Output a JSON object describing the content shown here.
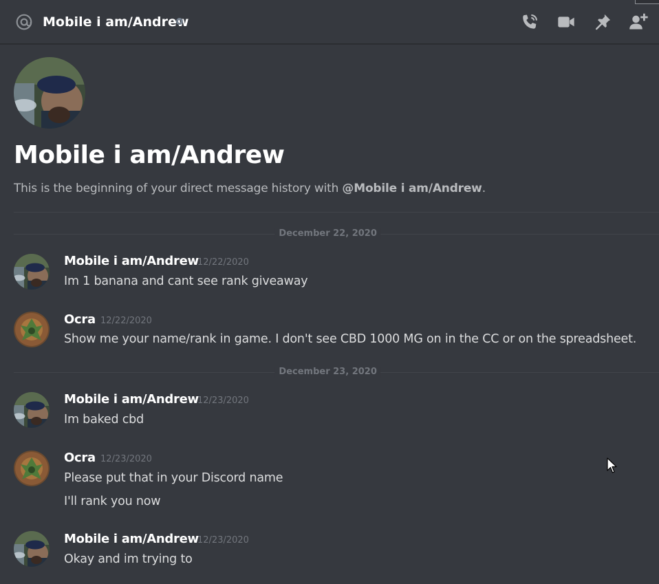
{
  "header": {
    "title": "Mobile i am/Andrew",
    "icons": [
      "at-icon",
      "status-offline-dot",
      "call-icon",
      "video-icon",
      "pin-icon",
      "add-friend-icon"
    ]
  },
  "intro": {
    "title": "Mobile i am/Andrew",
    "subtitle_prefix": "This is the beginning of your direct message history with ",
    "subtitle_mention": "@Mobile i am/Andrew",
    "subtitle_suffix": "."
  },
  "dividers": [
    {
      "date": "December 22, 2020"
    },
    {
      "date": "December 23, 2020"
    }
  ],
  "messages": [
    {
      "author": "Mobile i am/Andrew",
      "timestamp": "12/22/2020",
      "lines": [
        "Im 1 banana and cant see rank giveaway"
      ]
    },
    {
      "author": "Ocra",
      "timestamp": "12/22/2020",
      "lines": [
        "Show me your name/rank in game. I don't see CBD 1000 MG on in the CC or on the spreadsheet."
      ]
    },
    {
      "author": "Mobile i am/Andrew",
      "timestamp": "12/23/2020",
      "lines": [
        "Im baked cbd"
      ]
    },
    {
      "author": "Ocra",
      "timestamp": "12/23/2020",
      "lines": [
        "Please put that in your Discord name",
        "I'll rank you now"
      ]
    },
    {
      "author": "Mobile i am/Andrew",
      "timestamp": "12/23/2020",
      "lines": [
        "Okay and im trying to"
      ]
    }
  ],
  "colors": {
    "background": "#36393f",
    "author": "#ffffff",
    "text": "#dcddde",
    "muted": "#72767d",
    "icon": "#b9bbbe"
  }
}
